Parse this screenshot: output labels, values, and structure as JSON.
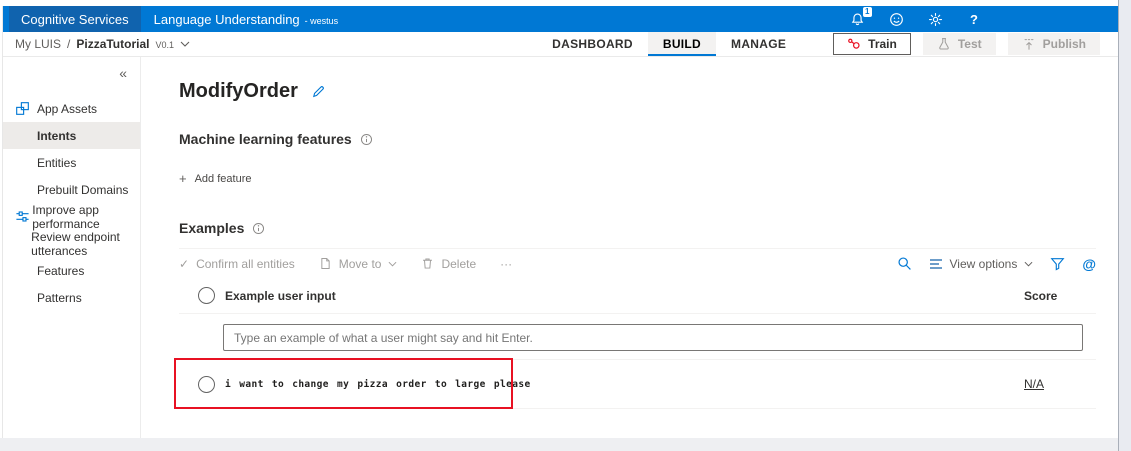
{
  "topbar": {
    "brand": "Cognitive Services",
    "product": "Language Understanding",
    "region": "- westus",
    "notification_badge": "1",
    "help_glyph": "?"
  },
  "breadcrumb": {
    "root": "My LUIS",
    "separator": "/",
    "app_name": "PizzaTutorial",
    "version": "V0.1"
  },
  "nav": {
    "tabs": [
      {
        "label": "DASHBOARD"
      },
      {
        "label": "BUILD"
      },
      {
        "label": "MANAGE"
      }
    ],
    "buttons": {
      "train": "Train",
      "test": "Test",
      "publish": "Publish"
    }
  },
  "sidebar": {
    "collapse_glyph": "«",
    "items": [
      {
        "label": "App Assets"
      },
      {
        "label": "Intents"
      },
      {
        "label": "Entities"
      },
      {
        "label": "Prebuilt Domains"
      },
      {
        "label": "Improve app performance"
      },
      {
        "label": "Review endpoint utterances"
      },
      {
        "label": "Features"
      },
      {
        "label": "Patterns"
      }
    ]
  },
  "main": {
    "title": "ModifyOrder",
    "ml_features": {
      "heading": "Machine learning features",
      "add_feature": "Add feature",
      "plus_glyph": "+"
    },
    "examples": {
      "heading": "Examples",
      "toolbar": {
        "confirm_glyph": "✓",
        "confirm": "Confirm all entities",
        "move_to": "Move to",
        "delete": "Delete",
        "more": "···",
        "view_options": "View options",
        "at_glyph": "@"
      },
      "table": {
        "col_input": "Example user input",
        "col_score": "Score",
        "input_placeholder": "Type an example of what a user might say and hit Enter.",
        "rows": [
          {
            "text": "i want to change my pizza order to large please",
            "score": "N/A"
          }
        ]
      }
    }
  },
  "colors": {
    "topbar_blue": "#0078D4",
    "brand_blue": "#1063AE",
    "accent_blue": "#0078D4",
    "highlight_red": "#E81123",
    "disabled_gray": "#A19F9D",
    "selected_item_bg": "#EDEBE9"
  }
}
